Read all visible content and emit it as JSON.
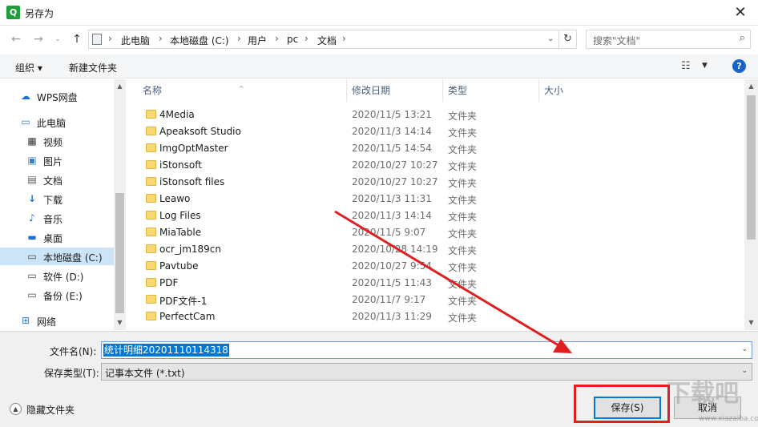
{
  "window": {
    "title": "另存为",
    "app_icon_letter": "Q"
  },
  "address_bar": {
    "breadcrumbs": [
      "此电脑",
      "本地磁盘 (C:)",
      "用户",
      "pc",
      "文档"
    ],
    "separator": "›"
  },
  "search": {
    "placeholder": "搜索\"文档\""
  },
  "toolbar": {
    "organize_label": "组织 ▾",
    "new_folder_label": "新建文件夹",
    "help_label": "?"
  },
  "sidebar": {
    "items": [
      {
        "label": "WPS网盘",
        "icon": "cloud-icon"
      },
      {
        "label": "此电脑",
        "icon": "computer-icon"
      },
      {
        "label": "视频",
        "icon": "video-icon"
      },
      {
        "label": "图片",
        "icon": "pictures-icon"
      },
      {
        "label": "文档",
        "icon": "documents-icon"
      },
      {
        "label": "下载",
        "icon": "download-icon"
      },
      {
        "label": "音乐",
        "icon": "music-icon"
      },
      {
        "label": "桌面",
        "icon": "desktop-icon"
      },
      {
        "label": "本地磁盘 (C:)",
        "icon": "drive-icon",
        "selected": true
      },
      {
        "label": "软件 (D:)",
        "icon": "drive-icon"
      },
      {
        "label": "备份 (E:)",
        "icon": "drive-icon"
      },
      {
        "label": "网络",
        "icon": "network-icon"
      }
    ]
  },
  "columns": {
    "name": "名称",
    "date": "修改日期",
    "type": "类型",
    "size": "大小"
  },
  "files": [
    {
      "name": "4Media",
      "date": "2020/11/5 13:21",
      "type": "文件夹"
    },
    {
      "name": "Apeaksoft Studio",
      "date": "2020/11/3 14:14",
      "type": "文件夹"
    },
    {
      "name": "ImgOptMaster",
      "date": "2020/11/5 14:54",
      "type": "文件夹"
    },
    {
      "name": "iStonsoft",
      "date": "2020/10/27 10:27",
      "type": "文件夹"
    },
    {
      "name": "iStonsoft files",
      "date": "2020/10/27 10:27",
      "type": "文件夹"
    },
    {
      "name": "Leawo",
      "date": "2020/11/3 11:31",
      "type": "文件夹"
    },
    {
      "name": "Log Files",
      "date": "2020/11/3 14:14",
      "type": "文件夹"
    },
    {
      "name": "MiaTable",
      "date": "2020/11/5 9:07",
      "type": "文件夹"
    },
    {
      "name": "ocr_jm189cn",
      "date": "2020/10/28 14:19",
      "type": "文件夹"
    },
    {
      "name": "Pavtube",
      "date": "2020/10/27 9:54",
      "type": "文件夹"
    },
    {
      "name": "PDF",
      "date": "2020/11/5 11:43",
      "type": "文件夹"
    },
    {
      "name": "PDF文件-1",
      "date": "2020/11/7 9:17",
      "type": "文件夹"
    },
    {
      "name": "PerfectCam",
      "date": "2020/11/3 11:29",
      "type": "文件夹"
    }
  ],
  "form": {
    "filename_label": "文件名(N):",
    "filename_value": "统计明细20201110114318",
    "filetype_label": "保存类型(T):",
    "filetype_value": "记事本文件 (*.txt)",
    "hide_folders_label": "隐藏文件夹",
    "save_label": "保存(S)",
    "cancel_label": "取消"
  },
  "watermark": {
    "text": "下载吧",
    "url": "www.xiazaiba.com"
  },
  "colors": {
    "selection": "#cce4f7",
    "accent": "#0078d7",
    "annotation": "#e02020"
  }
}
